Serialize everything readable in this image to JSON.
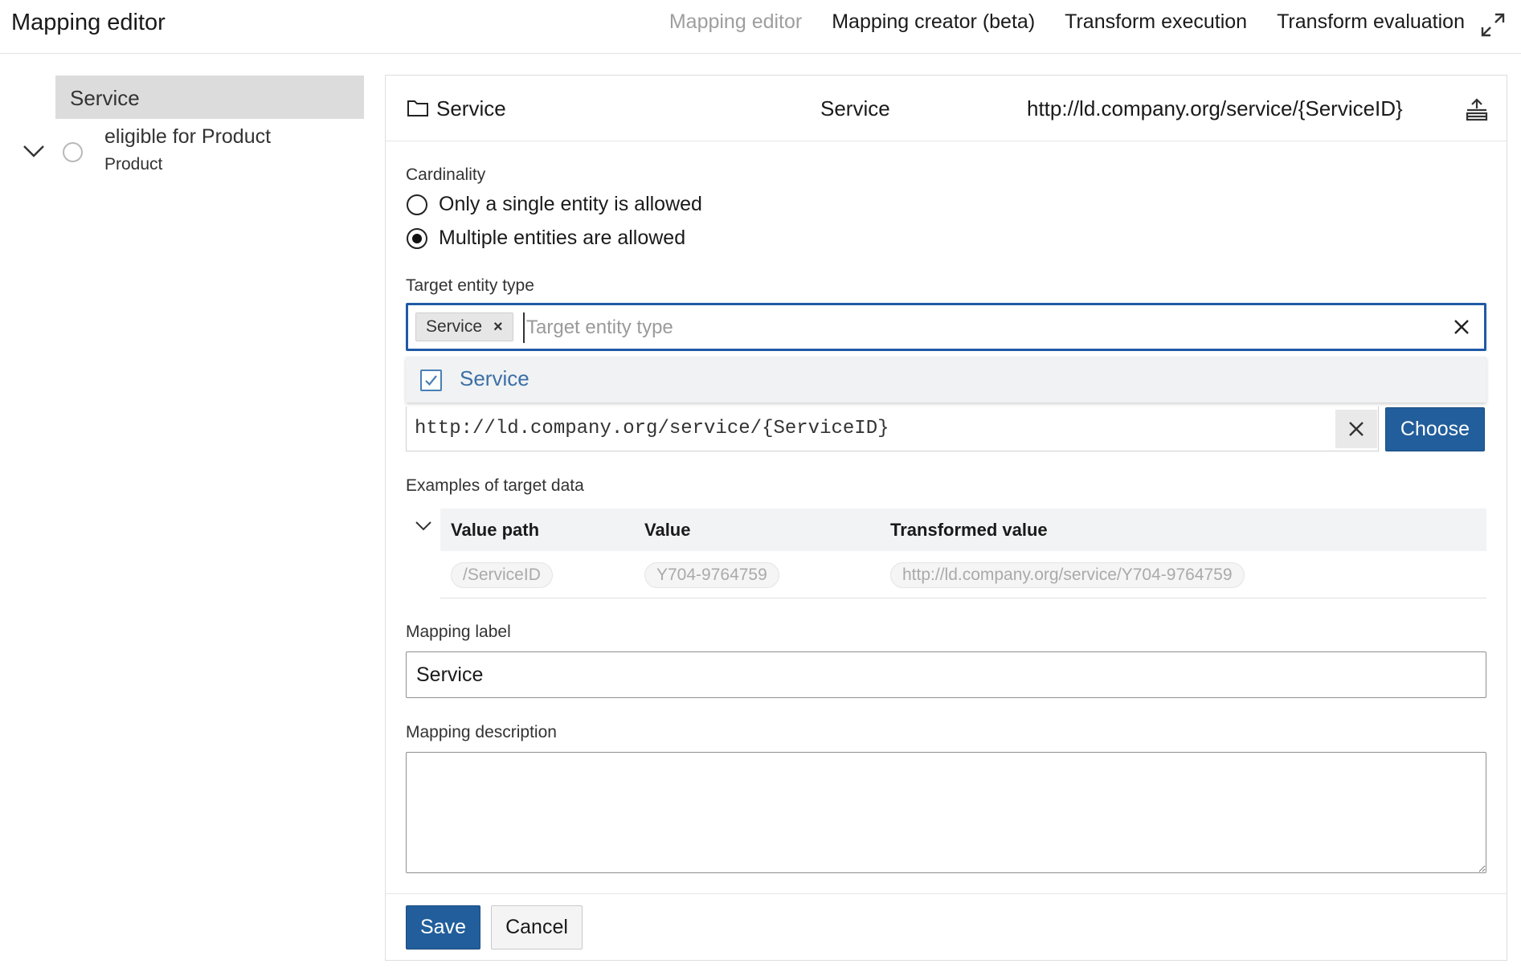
{
  "app": {
    "title": "Mapping editor"
  },
  "nav": {
    "items": [
      {
        "label": "Mapping editor",
        "active": true
      },
      {
        "label": "Mapping creator (beta)",
        "active": false
      },
      {
        "label": "Transform execution",
        "active": false
      },
      {
        "label": "Transform evaluation",
        "active": false
      }
    ],
    "expand_icon": "expand-icon"
  },
  "tree": {
    "root": {
      "label": "Service",
      "expanded": true
    },
    "children": [
      {
        "label": "eligible for Product",
        "sublabel": "Product"
      }
    ]
  },
  "editor": {
    "header": {
      "name": "Service",
      "type": "Service",
      "uri": "http://ld.company.org/service/{ServiceID}"
    },
    "cardinality": {
      "label": "Cardinality",
      "options": [
        {
          "label": "Only a single entity is allowed",
          "checked": false
        },
        {
          "label": "Multiple entities are allowed",
          "checked": true
        }
      ]
    },
    "target_entity_type": {
      "label": "Target entity type",
      "tag": "Service",
      "placeholder": "Target entity type",
      "dropdown_option": "Service",
      "dropdown_option_checked": true
    },
    "uri_pattern": {
      "value": "http://ld.company.org/service/{ServiceID}",
      "choose_label": "Choose"
    },
    "examples": {
      "label": "Examples of target data",
      "columns": [
        "Value path",
        "Value",
        "Transformed value"
      ],
      "rows": [
        {
          "path": "/ServiceID",
          "value": "Y704-9764759",
          "transformed": "http://ld.company.org/service/Y704-9764759"
        }
      ]
    },
    "mapping_label": {
      "label": "Mapping label",
      "value": "Service"
    },
    "mapping_description": {
      "label": "Mapping description",
      "value": ""
    },
    "footer": {
      "save_label": "Save",
      "cancel_label": "Cancel"
    }
  },
  "colors": {
    "primary": "#215e9b",
    "focus_border": "#1f5aa6",
    "link": "#3b6fa5",
    "muted": "#9e9e9e"
  }
}
